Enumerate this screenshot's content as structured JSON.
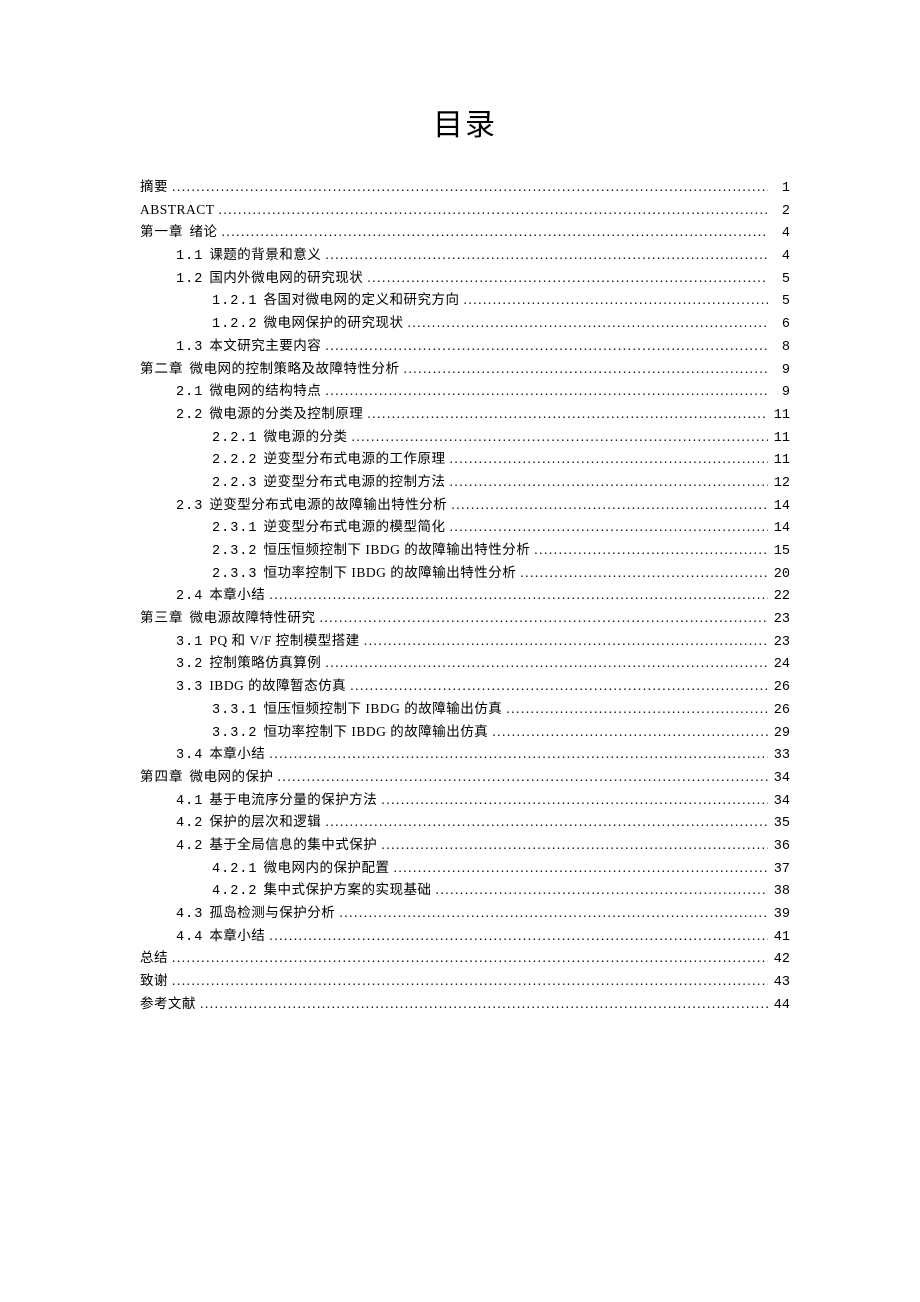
{
  "title": "目录",
  "entries": [
    {
      "level": 0,
      "num": "",
      "label": "摘要",
      "page": "1"
    },
    {
      "level": 0,
      "num": "",
      "label": "ABSTRACT",
      "page": "2"
    },
    {
      "level": 0,
      "num": "第一章",
      "label": "绪论",
      "page": "4"
    },
    {
      "level": 1,
      "num": "1.1",
      "label": "课题的背景和意义",
      "page": "4"
    },
    {
      "level": 1,
      "num": "1.2",
      "label": "国内外微电网的研究现状",
      "page": "5"
    },
    {
      "level": 2,
      "num": "1.2.1",
      "label": "各国对微电网的定义和研究方向",
      "page": "5"
    },
    {
      "level": 2,
      "num": "1.2.2",
      "label": "微电网保护的研究现状",
      "page": "6"
    },
    {
      "level": 1,
      "num": "1.3",
      "label": "本文研究主要内容",
      "page": "8"
    },
    {
      "level": 0,
      "num": "第二章",
      "label": "微电网的控制策略及故障特性分析",
      "page": "9"
    },
    {
      "level": 1,
      "num": "2.1",
      "label": "微电网的结构特点",
      "page": "9"
    },
    {
      "level": 1,
      "num": "2.2",
      "label": "微电源的分类及控制原理",
      "page": "11"
    },
    {
      "level": 2,
      "num": "2.2.1",
      "label": "微电源的分类",
      "page": "11"
    },
    {
      "level": 2,
      "num": "2.2.2",
      "label": "逆变型分布式电源的工作原理",
      "page": "11"
    },
    {
      "level": 2,
      "num": "2.2.3",
      "label": "逆变型分布式电源的控制方法",
      "page": "12"
    },
    {
      "level": 1,
      "num": "2.3",
      "label": "逆变型分布式电源的故障输出特性分析",
      "page": "14"
    },
    {
      "level": 2,
      "num": "2.3.1",
      "label": "逆变型分布式电源的模型简化",
      "page": "14"
    },
    {
      "level": 2,
      "num": "2.3.2",
      "label": "恒压恒频控制下 IBDG 的故障输出特性分析",
      "page": "15"
    },
    {
      "level": 2,
      "num": "2.3.3",
      "label": "恒功率控制下 IBDG 的故障输出特性分析",
      "page": "20"
    },
    {
      "level": 1,
      "num": "2.4",
      "label": "本章小结",
      "page": "22"
    },
    {
      "level": 0,
      "num": "第三章",
      "label": "微电源故障特性研究",
      "page": "23"
    },
    {
      "level": 1,
      "num": "3.1",
      "label": "PQ 和 V/F 控制模型搭建",
      "page": "23"
    },
    {
      "level": 1,
      "num": "3.2",
      "label": "控制策略仿真算例",
      "page": "24"
    },
    {
      "level": 1,
      "num": "3.3",
      "label": "IBDG 的故障暂态仿真",
      "page": "26"
    },
    {
      "level": 2,
      "num": "3.3.1",
      "label": "恒压恒频控制下 IBDG 的故障输出仿真",
      "page": "26"
    },
    {
      "level": 2,
      "num": "3.3.2",
      "label": "恒功率控制下 IBDG 的故障输出仿真",
      "page": "29"
    },
    {
      "level": 1,
      "num": "3.4",
      "label": "本章小结",
      "page": "33"
    },
    {
      "level": 0,
      "num": "第四章",
      "label": "微电网的保护",
      "page": "34"
    },
    {
      "level": 1,
      "num": "4.1",
      "label": "基于电流序分量的保护方法",
      "page": "34"
    },
    {
      "level": 1,
      "num": "4.2",
      "label": "保护的层次和逻辑",
      "page": "35"
    },
    {
      "level": 1,
      "num": "4.2",
      "label": "基于全局信息的集中式保护",
      "page": "36"
    },
    {
      "level": 2,
      "num": "4.2.1",
      "label": "微电网内的保护配置",
      "page": "37"
    },
    {
      "level": 2,
      "num": "4.2.2",
      "label": "集中式保护方案的实现基础",
      "page": "38"
    },
    {
      "level": 1,
      "num": "4.3",
      "label": "孤岛检测与保护分析",
      "page": "39"
    },
    {
      "level": 1,
      "num": "4.4",
      "label": "本章小结",
      "page": "41"
    },
    {
      "level": 0,
      "num": "",
      "label": "总结",
      "page": "42"
    },
    {
      "level": 0,
      "num": "",
      "label": "致谢",
      "page": "43"
    },
    {
      "level": 0,
      "num": "",
      "label": "参考文献",
      "page": "44"
    }
  ]
}
